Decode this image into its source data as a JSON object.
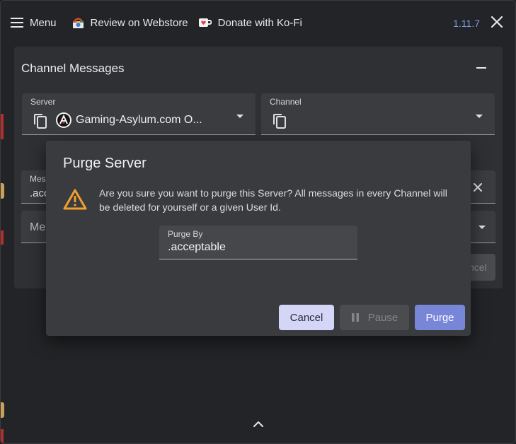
{
  "topbar": {
    "menu_label": "Menu",
    "webstore_label": "Review on Webstore",
    "donate_label": "Donate with Ko-Fi",
    "version": "1.11.7"
  },
  "panel": {
    "title": "Channel Messages",
    "server_field": {
      "label": "Server",
      "value": "Gaming-Asylum.com O..."
    },
    "channel_field": {
      "label": "Channel",
      "value": ""
    },
    "messages_field": {
      "label": "Mes",
      "value": ".acc"
    },
    "second_field": {
      "value": "Me"
    },
    "cancel_ghost": "ncel"
  },
  "dialog": {
    "title": "Purge Server",
    "message": "Are you sure you want to purge this Server? All messages in every Channel will be deleted for yourself or a given User Id.",
    "purge_by_label": "Purge By",
    "purge_by_value": ".acceptable",
    "cancel_label": "Cancel",
    "pause_label": "Pause",
    "purge_label": "Purge"
  },
  "colors": {
    "accent": "#7886d7",
    "version": "#7f9ce8",
    "warning": "#f0a030",
    "cancel_bg": "#d4d6f8"
  }
}
